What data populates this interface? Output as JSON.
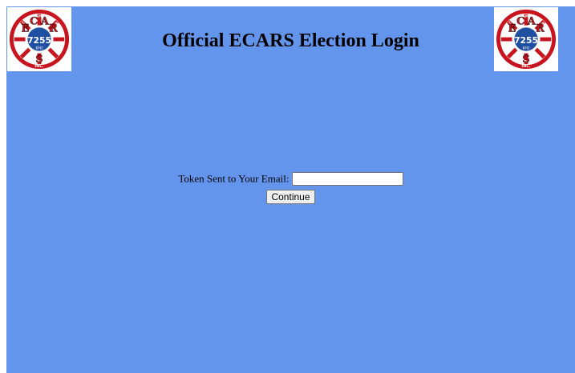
{
  "header": {
    "title": "Official ECARS Election Login"
  },
  "logo": {
    "ring_top": "EAST COAST AMATEUR RADIO",
    "ring_bottom": "SERVICE",
    "letters": [
      "E",
      "C",
      "A",
      "R",
      "S"
    ],
    "frequency": "7255",
    "unit": "kHz",
    "suffix": "INC.",
    "colors": {
      "ring": "#C8141E",
      "center": "#1F4FA0",
      "letter_fill": "#ffffff"
    }
  },
  "form": {
    "token_label": "Token Sent to Your Email:",
    "token_value": "",
    "continue_label": "Continue"
  },
  "colors": {
    "background": "#6495ED"
  }
}
